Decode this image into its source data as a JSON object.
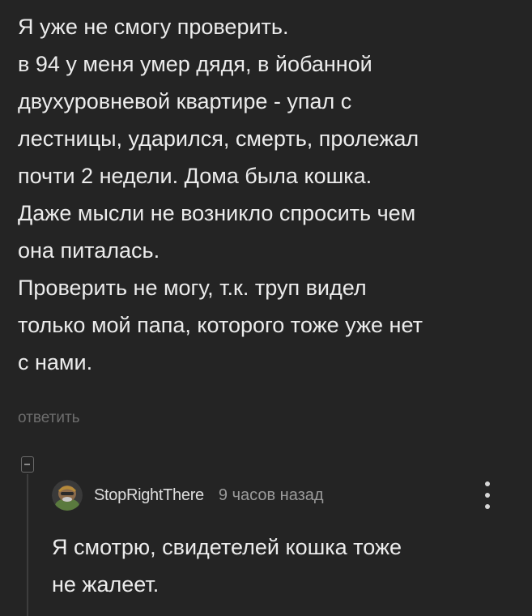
{
  "comment": {
    "lines": [
      "Я уже не смогу проверить.",
      "в 94 у меня умер дядя, в йобанной",
      "двухуровневой квартире - упал с",
      "лестницы, ударился, смерть, пролежал",
      "почти 2 недели. Дома была кошка.",
      "Даже мысли не возникло спросить чем",
      "она питалась.",
      "Проверить не могу, т.к. труп видел",
      "только мой папа, которого тоже уже нет",
      "с нами."
    ],
    "reply_label": "ответить"
  },
  "reply": {
    "username": "StopRightThere",
    "timestamp": "9 часов назад",
    "lines": [
      "Я смотрю, свидетелей кошка тоже",
      "не жалеет."
    ]
  },
  "icons": {
    "collapse": "collapse-thread-icon",
    "more": "more-vertical-icon",
    "avatar": "user-avatar"
  },
  "colors": {
    "background": "#242424",
    "text": "#ececec",
    "muted": "#6d6d6d"
  }
}
